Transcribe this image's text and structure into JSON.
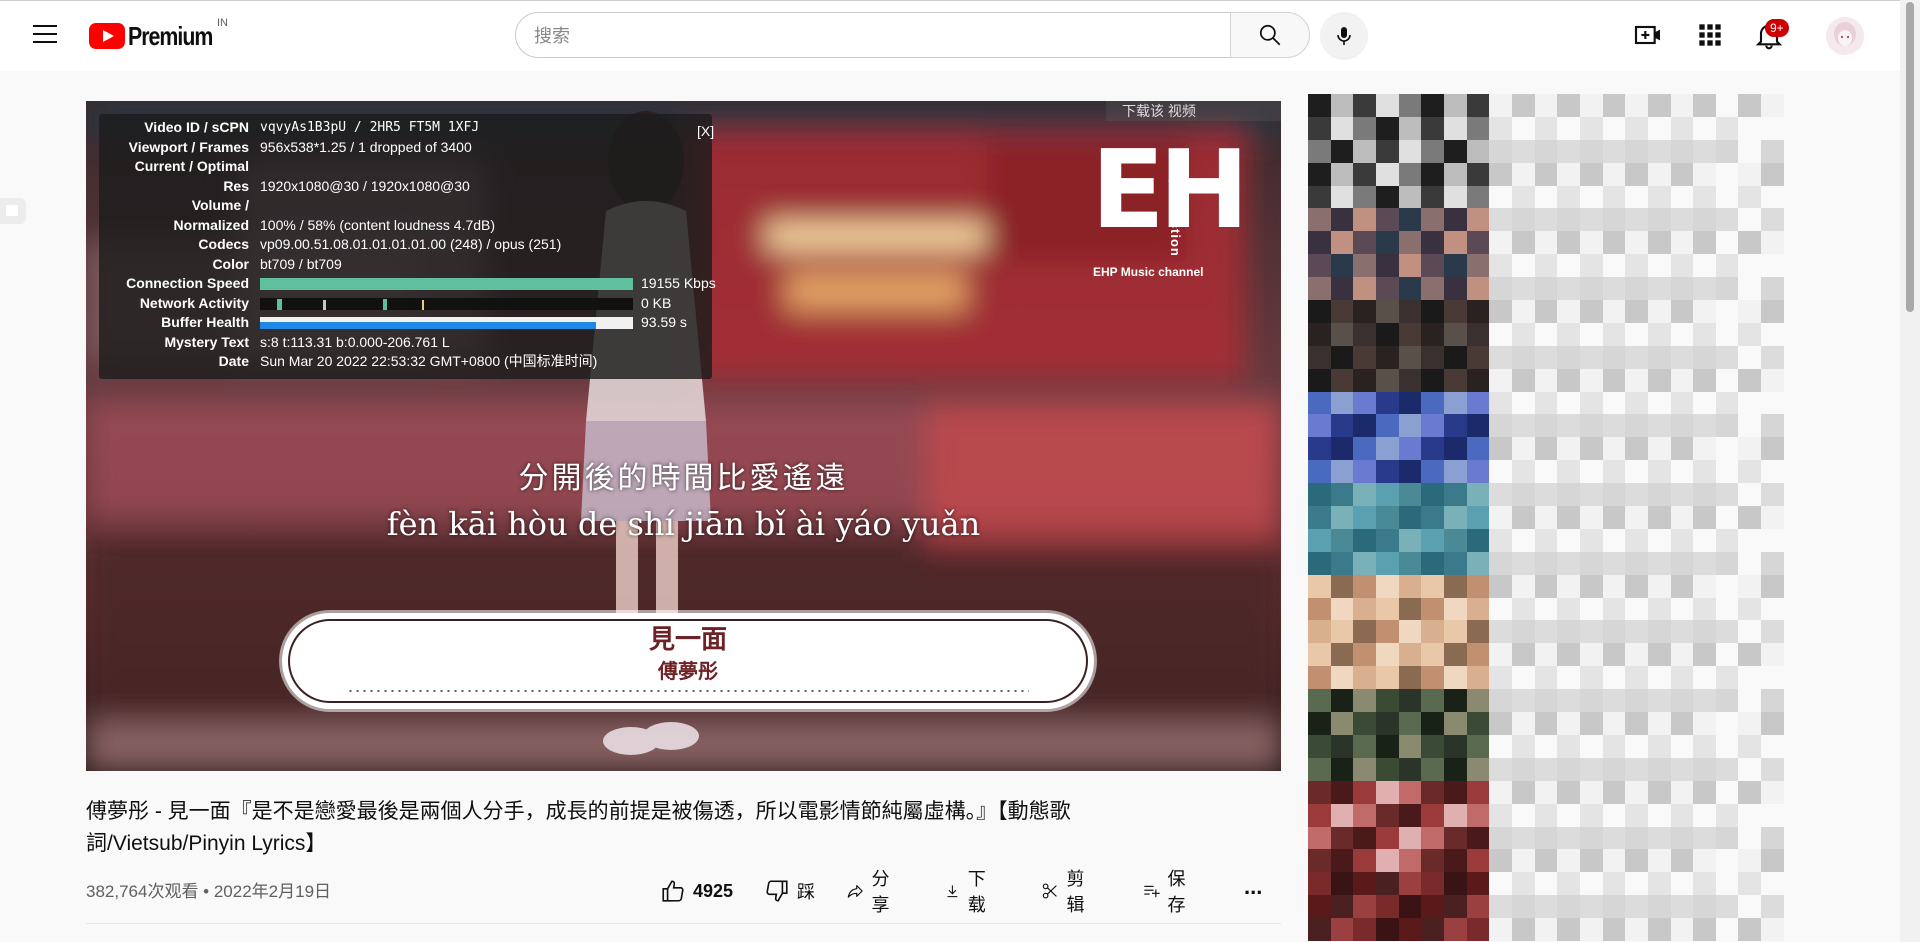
{
  "header": {
    "brand": "Premium",
    "region": "IN",
    "search_placeholder": "搜索",
    "notifications_badge": "9+"
  },
  "stats_for_nerds": {
    "close_label": "[X]",
    "rows": [
      {
        "key": "Video ID / sCPN",
        "value": "vqvyAs1B3pU / 2HR5 FT5M 1XFJ"
      },
      {
        "key": "Viewport / Frames",
        "value": "956x538*1.25 / 1 dropped of 3400"
      },
      {
        "key": "Current / Optimal",
        "value": ""
      },
      {
        "key": "Res",
        "value": "1920x1080@30 / 1920x1080@30"
      },
      {
        "key": "Volume /",
        "value": ""
      },
      {
        "key": "Normalized",
        "value": "100% / 58% (content loudness 4.7dB)"
      },
      {
        "key": "Codecs",
        "value": "vp09.00.51.08.01.01.01.01.00 (248) / opus (251)"
      },
      {
        "key": "Color",
        "value": "bt709 / bt709"
      },
      {
        "key": "Connection Speed",
        "value": "19155 Kbps"
      },
      {
        "key": "Network Activity",
        "value": "0 KB"
      },
      {
        "key": "Buffer Health",
        "value": "93.59 s"
      },
      {
        "key": "Mystery Text",
        "value": "s:8 t:113.31 b:0.000-206.761 L"
      },
      {
        "key": "Date",
        "value": "Sun Mar 20 2022 22:53:32 GMT+0800 (中国标准时间)"
      }
    ],
    "connection_speed_fraction": 1.0,
    "buffer_health_fraction": 0.9
  },
  "video": {
    "download_banner": "下载该 视频",
    "watermark_letters": "EH",
    "watermark_vertical": "production",
    "watermark_sub": "EHP Music channel",
    "lyric_line_1": "分開後的時間比愛遙遠",
    "lyric_line_2": "fèn kāi hòu de shí jiān bǐ ài yáo yuǎn",
    "song_title": "見一面",
    "song_artist": "傅夢彤"
  },
  "info": {
    "title": "傅夢彤 - 見一面『是不是戀愛最後是兩個人分手，成長的前提是被傷透，所以電影情節純屬虛構。』【動態歌詞/Vietsub/Pinyin Lyrics】",
    "views_date": "382,764次观看 • 2022年2月19日",
    "like_count": "4925",
    "dislike_label": "踩",
    "share_label": "分享",
    "download_label": "下载",
    "clip_label": "剪辑",
    "save_label": "保存",
    "more_label": "..."
  },
  "colors": {
    "brand_red": "#ff0000",
    "badge_red": "#cc0000",
    "connection_bar": "#5fbf9f",
    "buffer_bar": "#1e88e5"
  }
}
